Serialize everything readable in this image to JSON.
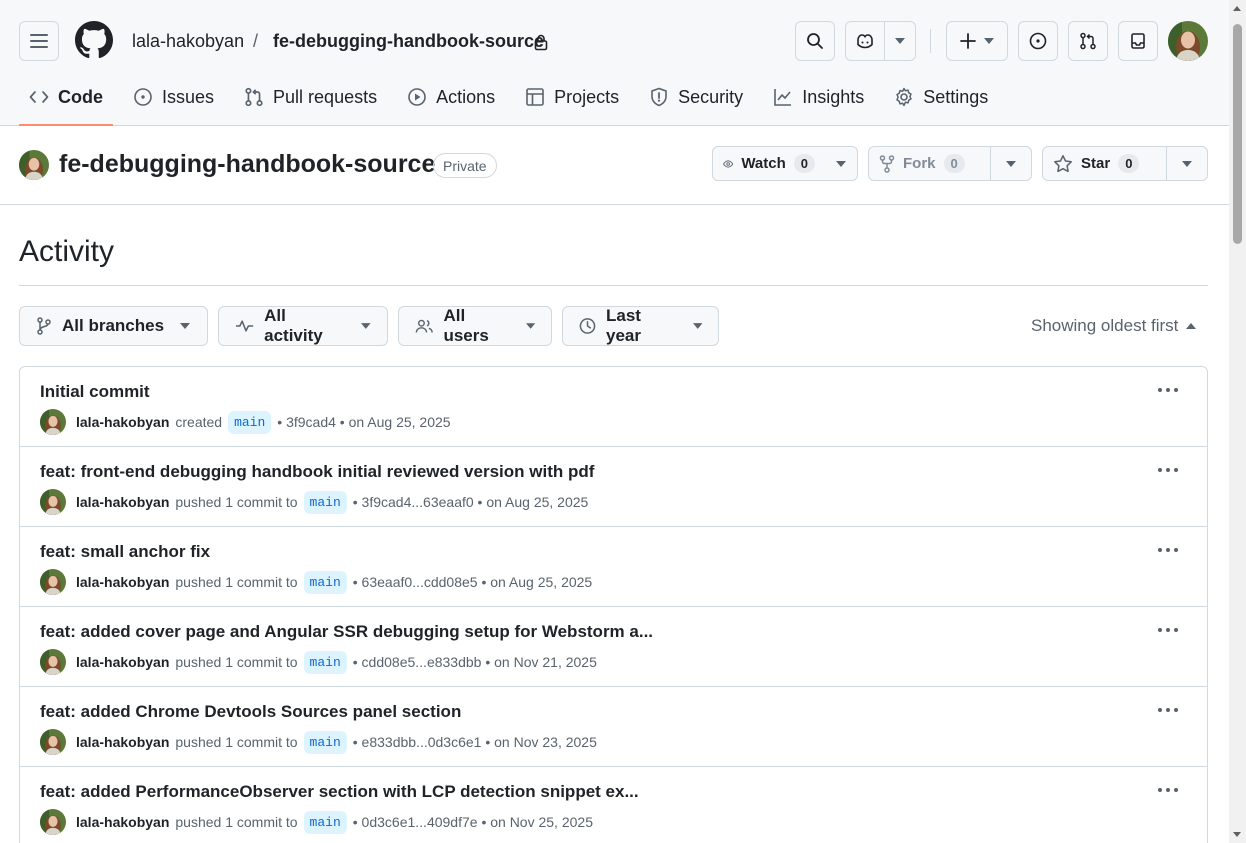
{
  "colors": {
    "accent_underline": "#fd8c73",
    "branch_chip_bg": "#ddf4ff",
    "branch_chip_text": "#0969da",
    "border": "#d1d9e0",
    "muted": "#59636e"
  },
  "header": {
    "owner": "lala-hakobyan",
    "separator": "/",
    "repo": "fe-debugging-handbook-source",
    "icons": [
      "menu-icon",
      "github-logo-icon",
      "lock-icon",
      "search-icon",
      "copilot-icon",
      "plus-icon",
      "issue-opened-icon",
      "git-pull-request-icon",
      "inbox-icon"
    ]
  },
  "nav": {
    "tabs": [
      {
        "label": "Code",
        "icon": "code-icon",
        "active": true
      },
      {
        "label": "Issues",
        "icon": "issue-opened-icon"
      },
      {
        "label": "Pull requests",
        "icon": "git-pull-request-icon"
      },
      {
        "label": "Actions",
        "icon": "play-icon"
      },
      {
        "label": "Projects",
        "icon": "table-icon"
      },
      {
        "label": "Security",
        "icon": "shield-icon"
      },
      {
        "label": "Insights",
        "icon": "graph-icon"
      },
      {
        "label": "Settings",
        "icon": "gear-icon"
      }
    ]
  },
  "repo": {
    "title": "fe-debugging-handbook-source",
    "visibility": "Private",
    "watch_label": "Watch",
    "watch_count": "0",
    "fork_label": "Fork",
    "fork_count": "0",
    "star_label": "Star",
    "star_count": "0"
  },
  "activity": {
    "title": "Activity",
    "filters": {
      "branches": "All branches",
      "activity": "All activity",
      "users": "All users",
      "period": "Last year"
    },
    "sort": "Showing oldest first",
    "items": [
      {
        "title": "Initial commit",
        "user": "lala-hakobyan",
        "action": "created",
        "branch": "main",
        "ref": "• 3f9cad4 • on Aug 25, 2025"
      },
      {
        "title": "feat: front-end debugging handbook initial reviewed version with pdf",
        "user": "lala-hakobyan",
        "action": "pushed 1 commit to",
        "branch": "main",
        "ref": "• 3f9cad4...63eaaf0 • on Aug 25, 2025"
      },
      {
        "title": "feat: small anchor fix",
        "user": "lala-hakobyan",
        "action": "pushed 1 commit to",
        "branch": "main",
        "ref": "• 63eaaf0...cdd08e5 • on Aug 25, 2025"
      },
      {
        "title": "feat: added cover page and Angular SSR debugging setup for Webstorm a...",
        "user": "lala-hakobyan",
        "action": "pushed 1 commit to",
        "branch": "main",
        "ref": "• cdd08e5...e833dbb • on Nov 21, 2025"
      },
      {
        "title": "feat: added Chrome Devtools Sources panel section",
        "user": "lala-hakobyan",
        "action": "pushed 1 commit to",
        "branch": "main",
        "ref": "• e833dbb...0d3c6e1 • on Nov 23, 2025"
      },
      {
        "title": "feat: added PerformanceObserver section with LCP detection snippet ex...",
        "user": "lala-hakobyan",
        "action": "pushed 1 commit to",
        "branch": "main",
        "ref": "• 0d3c6e1...409df7e • on Nov 25, 2025"
      }
    ]
  }
}
